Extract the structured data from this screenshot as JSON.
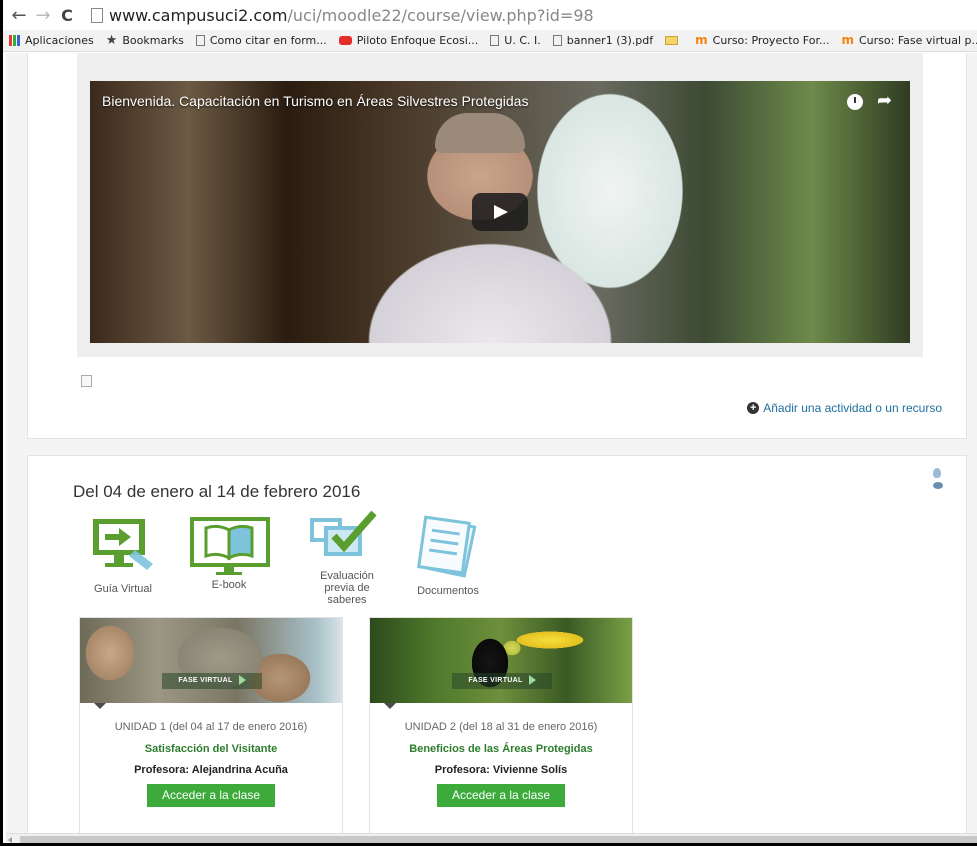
{
  "browser": {
    "back_glyph": "←",
    "forward_glyph": "→",
    "reload_glyph": "C",
    "url_host": "www.campusuci2.com",
    "url_path": "/uci/moodle22/course/view.php?id=98"
  },
  "bookmarks": [
    {
      "icon": "apps-icon",
      "label": "Aplicaciones"
    },
    {
      "icon": "star-icon",
      "label": "Bookmarks"
    },
    {
      "icon": "page-icon",
      "label": "Como citar en form..."
    },
    {
      "icon": "youtube-icon",
      "label": "Piloto Enfoque Ecosi..."
    },
    {
      "icon": "page-icon",
      "label": "U. C. I."
    },
    {
      "icon": "page-icon",
      "label": "banner1 (3).pdf"
    },
    {
      "icon": "folder-icon",
      "label": ""
    },
    {
      "icon": "moodle-icon",
      "label": "Curso: Proyecto For..."
    },
    {
      "icon": "moodle-icon",
      "label": "Curso: Fase virtual p..."
    }
  ],
  "video": {
    "title": "Bienvenida. Capacitación en Turismo en Áreas Silvestres Protegidas"
  },
  "section1": {
    "add_activity": "Añadir una actividad o un recurso"
  },
  "section2": {
    "title": "Del 04 de enero al 14 de febrero 2016",
    "tools": {
      "guia": "Guía Virtual",
      "ebook": "E-book",
      "evaluacion_1": "Evaluación",
      "evaluacion_2": "previa de",
      "evaluacion_3": "saberes",
      "documentos": "Documentos"
    },
    "cards": [
      {
        "badge": "FASE VIRTUAL",
        "unit": "UNIDAD 1 (del 04 al 17 de enero 2016)",
        "course": "Satisfacción del Visitante",
        "professor": "Profesora: Alejandrina Acuña",
        "button": "Acceder a la clase"
      },
      {
        "badge": "FASE VIRTUAL",
        "unit": "UNIDAD 2 (del 18 al 31 de enero 2016)",
        "course": "Beneficios de las Áreas Protegidas",
        "professor": "Profesora: Vivienne Solís",
        "button": "Acceder a la clase"
      }
    ]
  },
  "colors": {
    "accent_green": "#3cab3c",
    "link_blue": "#1f6f9f",
    "icon_green": "#5a9e2f",
    "icon_blue": "#7ec3dc"
  }
}
